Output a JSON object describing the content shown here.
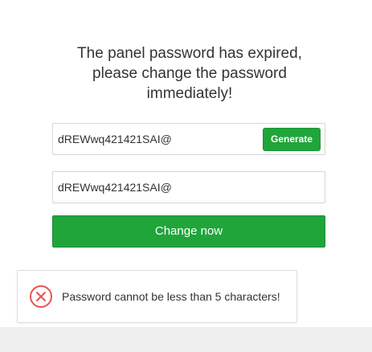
{
  "dialog": {
    "message_lines": [
      "The panel password has expired,",
      "please change the password",
      "immediately!"
    ]
  },
  "password_field": {
    "value": "dREWwq421421SAI@",
    "generate_label": "Generate"
  },
  "confirm_field": {
    "value": "dREWwq421421SAI@"
  },
  "submit": {
    "label": "Change now"
  },
  "toast": {
    "icon": "error-circle-icon",
    "message": "Password cannot be less than 5 characters!"
  },
  "colors": {
    "accent": "#20a53a",
    "error": "#e8544f"
  }
}
